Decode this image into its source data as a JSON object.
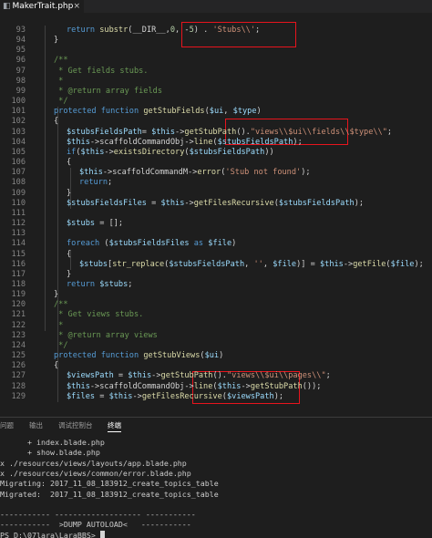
{
  "tab": {
    "title": "MakerTrait.php",
    "close": "×",
    "icon": "php-file"
  },
  "code_lines": [
    {
      "n": "93",
      "indent": 2,
      "tokens": [
        [
          "kw",
          "return "
        ],
        [
          "fn",
          "substr"
        ],
        [
          "plain",
          "(__DIR__,"
        ],
        [
          "num",
          "0"
        ],
        [
          "plain",
          ", -"
        ],
        [
          "num",
          "5"
        ],
        [
          "plain",
          ") . "
        ],
        [
          "str",
          "'Stubs\\\\'"
        ],
        [
          "plain",
          ";"
        ]
      ]
    },
    {
      "n": "94",
      "indent": 1,
      "tokens": [
        [
          "plain",
          "}"
        ]
      ]
    },
    {
      "n": "95",
      "indent": 0,
      "tokens": []
    },
    {
      "n": "96",
      "indent": 1,
      "tokens": [
        [
          "com",
          "/**"
        ]
      ]
    },
    {
      "n": "97",
      "indent": 1,
      "tokens": [
        [
          "com",
          " * Get fields stubs."
        ]
      ]
    },
    {
      "n": "98",
      "indent": 1,
      "tokens": [
        [
          "com",
          " *"
        ]
      ]
    },
    {
      "n": "99",
      "indent": 1,
      "tokens": [
        [
          "com",
          " * @return array fields"
        ]
      ]
    },
    {
      "n": "100",
      "indent": 1,
      "tokens": [
        [
          "com",
          " */"
        ]
      ]
    },
    {
      "n": "101",
      "indent": 1,
      "tokens": [
        [
          "kw",
          "protected function "
        ],
        [
          "fn",
          "getStubFields"
        ],
        [
          "plain",
          "("
        ],
        [
          "var",
          "$ui"
        ],
        [
          "plain",
          ", "
        ],
        [
          "var",
          "$type"
        ],
        [
          "plain",
          ")"
        ]
      ]
    },
    {
      "n": "102",
      "indent": 1,
      "tokens": [
        [
          "plain",
          "{"
        ]
      ]
    },
    {
      "n": "103",
      "indent": 2,
      "tokens": [
        [
          "var",
          "$stubsFieldsPath"
        ],
        [
          "plain",
          "= "
        ],
        [
          "var",
          "$this"
        ],
        [
          "plain",
          "->"
        ],
        [
          "fn",
          "getStubPath"
        ],
        [
          "plain",
          "()."
        ],
        [
          "str",
          "\"views\\\\$ui\\\\fields\\\\$type\\\\\""
        ],
        [
          "plain",
          ";"
        ]
      ]
    },
    {
      "n": "104",
      "indent": 2,
      "tokens": [
        [
          "var",
          "$this"
        ],
        [
          "plain",
          "->scaffoldCommandObj->"
        ],
        [
          "fn",
          "line"
        ],
        [
          "plain",
          "("
        ],
        [
          "var",
          "$stubsFieldsPath"
        ],
        [
          "plain",
          ");"
        ]
      ]
    },
    {
      "n": "105",
      "indent": 2,
      "tokens": [
        [
          "kw",
          "if"
        ],
        [
          "plain",
          "("
        ],
        [
          "var",
          "$this"
        ],
        [
          "plain",
          "->"
        ],
        [
          "fn",
          "existsDirectory"
        ],
        [
          "plain",
          "("
        ],
        [
          "var",
          "$stubsFieldsPath"
        ],
        [
          "plain",
          "))"
        ]
      ]
    },
    {
      "n": "106",
      "indent": 2,
      "tokens": [
        [
          "plain",
          "{"
        ]
      ]
    },
    {
      "n": "107",
      "indent": 3,
      "tokens": [
        [
          "var",
          "$this"
        ],
        [
          "plain",
          "->scaffoldCommandM->"
        ],
        [
          "fn",
          "error"
        ],
        [
          "plain",
          "("
        ],
        [
          "str",
          "'Stub not found'"
        ],
        [
          "plain",
          ");"
        ]
      ]
    },
    {
      "n": "108",
      "indent": 3,
      "tokens": [
        [
          "kw",
          "return"
        ],
        [
          "plain",
          ";"
        ]
      ]
    },
    {
      "n": "109",
      "indent": 2,
      "tokens": [
        [
          "plain",
          "}"
        ]
      ]
    },
    {
      "n": "110",
      "indent": 2,
      "tokens": [
        [
          "var",
          "$stubsFieldsFiles"
        ],
        [
          "plain",
          " = "
        ],
        [
          "var",
          "$this"
        ],
        [
          "plain",
          "->"
        ],
        [
          "fn",
          "getFilesRecursive"
        ],
        [
          "plain",
          "("
        ],
        [
          "var",
          "$stubsFieldsPath"
        ],
        [
          "plain",
          ");"
        ]
      ]
    },
    {
      "n": "111",
      "indent": 0,
      "tokens": []
    },
    {
      "n": "112",
      "indent": 2,
      "tokens": [
        [
          "var",
          "$stubs"
        ],
        [
          "plain",
          " = [];"
        ]
      ]
    },
    {
      "n": "113",
      "indent": 0,
      "tokens": []
    },
    {
      "n": "114",
      "indent": 2,
      "tokens": [
        [
          "kw",
          "foreach "
        ],
        [
          "plain",
          "("
        ],
        [
          "var",
          "$stubsFieldsFiles"
        ],
        [
          "kw",
          " as "
        ],
        [
          "var",
          "$file"
        ],
        [
          "plain",
          ")"
        ]
      ]
    },
    {
      "n": "115",
      "indent": 2,
      "tokens": [
        [
          "plain",
          "{"
        ]
      ]
    },
    {
      "n": "116",
      "indent": 3,
      "tokens": [
        [
          "var",
          "$stubs"
        ],
        [
          "plain",
          "["
        ],
        [
          "fn",
          "str_replace"
        ],
        [
          "plain",
          "("
        ],
        [
          "var",
          "$stubsFieldsPath"
        ],
        [
          "plain",
          ", "
        ],
        [
          "str",
          "''"
        ],
        [
          "plain",
          ", "
        ],
        [
          "var",
          "$file"
        ],
        [
          "plain",
          ")] = "
        ],
        [
          "var",
          "$this"
        ],
        [
          "plain",
          "->"
        ],
        [
          "fn",
          "getFile"
        ],
        [
          "plain",
          "("
        ],
        [
          "var",
          "$file"
        ],
        [
          "plain",
          ");"
        ]
      ]
    },
    {
      "n": "117",
      "indent": 2,
      "tokens": [
        [
          "plain",
          "}"
        ]
      ]
    },
    {
      "n": "118",
      "indent": 2,
      "tokens": [
        [
          "kw",
          "return "
        ],
        [
          "var",
          "$stubs"
        ],
        [
          "plain",
          ";"
        ]
      ]
    },
    {
      "n": "119",
      "indent": 1,
      "tokens": [
        [
          "plain",
          "}"
        ]
      ]
    },
    {
      "n": "120",
      "indent": 1,
      "tokens": [
        [
          "com",
          "/**"
        ]
      ]
    },
    {
      "n": "121",
      "indent": 1,
      "tokens": [
        [
          "com",
          " * Get views stubs."
        ]
      ]
    },
    {
      "n": "122",
      "indent": 1,
      "tokens": [
        [
          "com",
          " *"
        ]
      ]
    },
    {
      "n": "123",
      "indent": 1,
      "tokens": [
        [
          "com",
          " * @return array views"
        ]
      ]
    },
    {
      "n": "124",
      "indent": 1,
      "tokens": [
        [
          "com",
          " */"
        ]
      ]
    },
    {
      "n": "125",
      "indent": 1,
      "tokens": [
        [
          "kw",
          "protected function "
        ],
        [
          "fn",
          "getStubViews"
        ],
        [
          "plain",
          "("
        ],
        [
          "var",
          "$ui"
        ],
        [
          "plain",
          ")"
        ]
      ]
    },
    {
      "n": "126",
      "indent": 1,
      "tokens": [
        [
          "plain",
          "{"
        ]
      ]
    },
    {
      "n": "127",
      "indent": 2,
      "tokens": [
        [
          "var",
          "$viewsPath"
        ],
        [
          "plain",
          " = "
        ],
        [
          "var",
          "$this"
        ],
        [
          "plain",
          "->"
        ],
        [
          "fn",
          "getStubPath"
        ],
        [
          "plain",
          "()."
        ],
        [
          "str",
          "\"views\\\\$ui\\\\pages\\\\\""
        ],
        [
          "plain",
          ";"
        ]
      ]
    },
    {
      "n": "128",
      "indent": 2,
      "tokens": [
        [
          "var",
          "$this"
        ],
        [
          "plain",
          "->scaffoldCommandObj->"
        ],
        [
          "fn",
          "line"
        ],
        [
          "plain",
          "("
        ],
        [
          "var",
          "$this"
        ],
        [
          "plain",
          "->"
        ],
        [
          "fn",
          "getStubPath"
        ],
        [
          "plain",
          "());"
        ]
      ]
    },
    {
      "n": "129",
      "indent": 2,
      "tokens": [
        [
          "var",
          "$files"
        ],
        [
          "plain",
          " = "
        ],
        [
          "var",
          "$this"
        ],
        [
          "plain",
          "->"
        ],
        [
          "fn",
          "getFilesRecursive"
        ],
        [
          "plain",
          "("
        ],
        [
          "var",
          "$viewsPath"
        ],
        [
          "plain",
          ");"
        ]
      ]
    }
  ],
  "panel_tabs": [
    {
      "label": "问题",
      "active": false
    },
    {
      "label": "输出",
      "active": false
    },
    {
      "label": "调试控制台",
      "active": false
    },
    {
      "label": "终端",
      "active": true
    }
  ],
  "terminal_lines": [
    "      + index.blade.php",
    "      + show.blade.php",
    "x ./resources/views/layouts/app.blade.php",
    "x ./resources/views/common/error.blade.php",
    "Migrating: 2017_11_08_183912_create_topics_table",
    "Migrated:  2017_11_08_183912_create_topics_table",
    "",
    "----------- ------------------- -----------",
    "-----------  >DUMP AUTOLOAD<   -----------",
    "PS D:\\07lara\\LaraBBS> "
  ],
  "colors": {
    "background": "#1e1e1e",
    "keyword": "#569cd6",
    "variable": "#9cdcfe",
    "function": "#dcdcaa",
    "string": "#ce9178",
    "comment": "#6a9955",
    "annotation_box": "#e8141d"
  }
}
